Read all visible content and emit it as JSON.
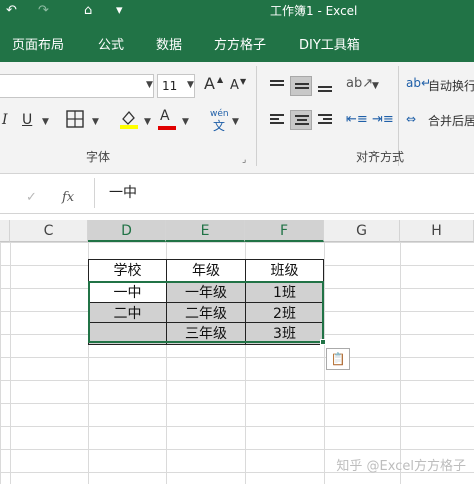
{
  "window": {
    "title": "工作簿1  -  Excel"
  },
  "quick_access": {
    "undo": "↶",
    "redo": "↷",
    "format_painter": "⌂",
    "customize": "▾"
  },
  "tabs": [
    "页面布局",
    "公式",
    "数据",
    "方方格子",
    "DIY工具箱"
  ],
  "ribbon": {
    "font_size": "11",
    "grow_font": "A",
    "shrink_font": "A",
    "italic": "I",
    "underline": "U",
    "highlight_letter": "A",
    "highlight_color": "#ffff00",
    "font_letter": "A",
    "font_color": "#e00000",
    "phonetic": "wén",
    "wrap_text": "自动换行",
    "merge_center": "合并后居",
    "group_font": "字体",
    "group_alignment": "对齐方式"
  },
  "formula_bar": {
    "confirm": "✓",
    "fx": "fx",
    "value": "一中"
  },
  "columns": [
    "C",
    "D",
    "E",
    "F",
    "G",
    "H"
  ],
  "selected_columns": [
    "D",
    "E",
    "F"
  ],
  "table": {
    "headers": [
      "学校",
      "年级",
      "班级"
    ],
    "rows": [
      [
        "一中",
        "一年级",
        "1班"
      ],
      [
        "二中",
        "二年级",
        "2班"
      ],
      [
        "",
        "三年级",
        "3班"
      ]
    ]
  },
  "watermark": "知乎 @Excel方方格子",
  "colors": {
    "accent": "#217346",
    "selection_fill": "#d1d1d1"
  },
  "icons": [
    "undo-icon",
    "redo-icon",
    "format-painter-icon",
    "paste-options-icon",
    "borders-icon",
    "wrap-text-icon",
    "merge-center-icon",
    "orientation-icon",
    "indent-icon"
  ]
}
